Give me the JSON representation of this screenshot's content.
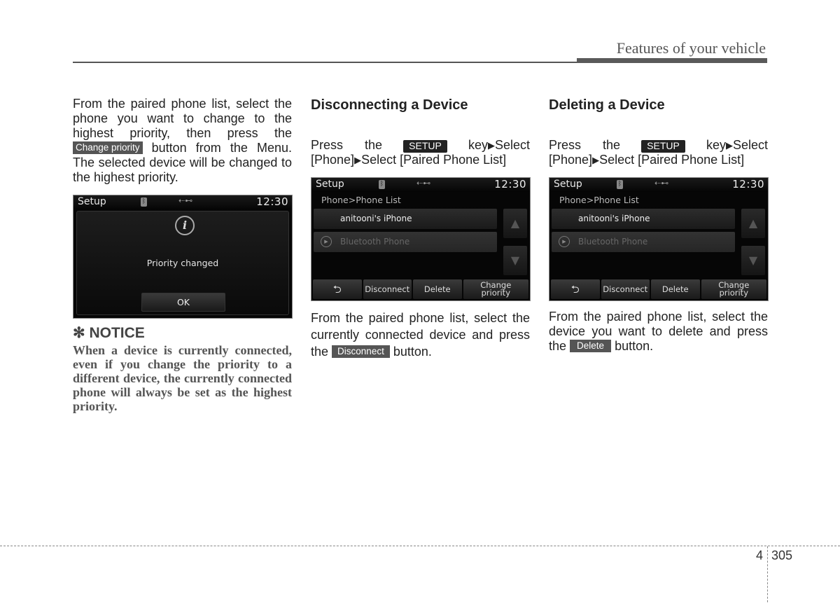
{
  "header": {
    "section_title": "Features of your vehicle"
  },
  "col1": {
    "intro_before": "From the paired phone list, select the phone you want to change to the highest priority, then press the",
    "intro_tag": "Change priority",
    "intro_after": "button from the Menu. The selected device will be changed to the highest priority.",
    "screen": {
      "status_title": "Setup",
      "time": "12:30",
      "message": "Priority changed",
      "ok_label": "OK"
    },
    "notice": {
      "symbol": "✻",
      "title": "NOTICE",
      "body": "When a device is currently connected, even if you change the priority to a different device, the currently connected phone will always be set as the highest priority."
    }
  },
  "col2": {
    "heading": "Disconnecting a Device",
    "step_press": "Press the",
    "step_key": "SETUP",
    "step_key_after": "key",
    "step_select1": "Select",
    "step_line2_a": "[Phone]",
    "step_line2_b": "Select [Paired Phone List]",
    "screen": {
      "status_title": "Setup",
      "time": "12:30",
      "breadcrumb": "Phone>Phone List",
      "items": [
        "anitooni's iPhone",
        "Bluetooth Phone"
      ],
      "buttons": [
        "Disconnect",
        "Delete",
        "Change priority"
      ]
    },
    "desc_before": "From the paired phone list, select the currently connected device and press the",
    "desc_tag": "Disconnect",
    "desc_after": "button."
  },
  "col3": {
    "heading": "Deleting a Device",
    "step_press": "Press the",
    "step_key": "SETUP",
    "step_key_after": "key",
    "step_select1": "Select",
    "step_line2_a": "[Phone]",
    "step_line2_b": "Select [Paired Phone List]",
    "screen": {
      "status_title": "Setup",
      "time": "12:30",
      "breadcrumb": "Phone>Phone List",
      "items": [
        "anitooni's iPhone",
        "Bluetooth Phone"
      ],
      "buttons": [
        "Disconnect",
        "Delete",
        "Change priority"
      ]
    },
    "desc_before": "From the paired phone list, select the device you want to delete and press the",
    "desc_tag": "Delete",
    "desc_after": "button."
  },
  "footer": {
    "chapter": "4",
    "page": "305"
  }
}
